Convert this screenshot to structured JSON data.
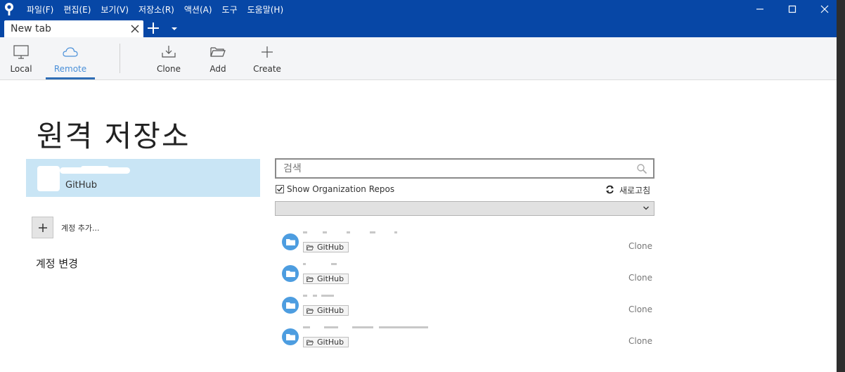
{
  "menu": [
    "파일(F)",
    "편집(E)",
    "보기(V)",
    "저장소(R)",
    "액션(A)",
    "도구",
    "도움말(H)"
  ],
  "tab": {
    "label": "New tab"
  },
  "toolbar": {
    "local": "Local",
    "remote": "Remote",
    "clone": "Clone",
    "add": "Add",
    "create": "Create",
    "active": "Remote"
  },
  "page": {
    "title": "원격 저장소"
  },
  "account": {
    "provider": "GitHub"
  },
  "sidebar": {
    "add_account": "계정 추가...",
    "change_account": "계정 변경"
  },
  "search": {
    "placeholder": "검색",
    "value": ""
  },
  "options": {
    "show_org_repos": "Show Organization Repos",
    "show_org_repos_checked": true,
    "refresh": "새로고침"
  },
  "filter": {
    "selected": ""
  },
  "repos": [
    {
      "host": "GitHub",
      "action": "Clone"
    },
    {
      "host": "GitHub",
      "action": "Clone"
    },
    {
      "host": "GitHub",
      "action": "Clone"
    },
    {
      "host": "GitHub",
      "action": "Clone"
    }
  ],
  "colors": {
    "titlebar": "#0747a6",
    "accent": "#2f6db5",
    "selected_account": "#c9e5f5",
    "folder_icon": "#4d9de0"
  },
  "icons": {
    "app": "sourcetree-logo-icon",
    "local": "monitor-icon",
    "remote": "cloud-icon",
    "clone": "download-tray-icon",
    "add": "open-folder-icon",
    "create": "plus-icon",
    "search": "magnifier-icon",
    "refresh": "refresh-icon",
    "repo": "folder-icon"
  }
}
